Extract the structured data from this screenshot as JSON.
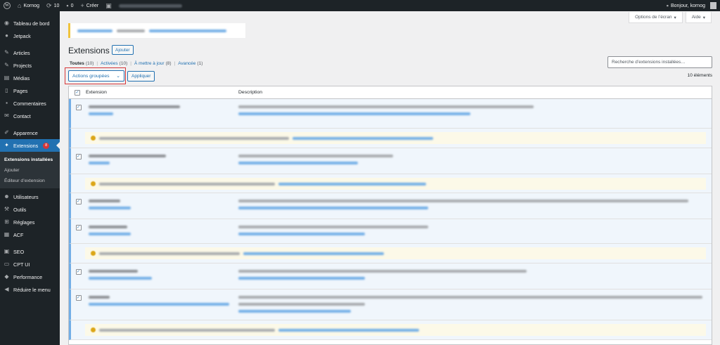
{
  "adminbar": {
    "site_name": "Kornog",
    "updates_count": "10",
    "comments_count": "0",
    "new_label": "Créer",
    "greeting": "Bonjour, kornog"
  },
  "sidebar": {
    "items": [
      {
        "label": "Tableau de bord",
        "icon": "dashboard-icon"
      },
      {
        "label": "Jetpack",
        "icon": "jetpack-icon"
      },
      {
        "label": "Articles",
        "icon": "pin-icon"
      },
      {
        "label": "Projects",
        "icon": "projects-icon"
      },
      {
        "label": "Médias",
        "icon": "media-icon"
      },
      {
        "label": "Pages",
        "icon": "pages-icon"
      },
      {
        "label": "Commentaires",
        "icon": "comments-icon"
      },
      {
        "label": "Contact",
        "icon": "mail-icon"
      },
      {
        "label": "Apparence",
        "icon": "brush-icon"
      },
      {
        "label": "Extensions",
        "icon": "plugins-icon",
        "badge": "8"
      },
      {
        "label": "Utilisateurs",
        "icon": "users-icon"
      },
      {
        "label": "Outils",
        "icon": "tools-icon"
      },
      {
        "label": "Réglages",
        "icon": "settings-icon"
      },
      {
        "label": "ACF",
        "icon": "acf-icon"
      },
      {
        "label": "SEO",
        "icon": "seo-icon"
      },
      {
        "label": "CPT UI",
        "icon": "cptui-icon"
      },
      {
        "label": "Performance",
        "icon": "performance-icon"
      },
      {
        "label": "Réduire le menu",
        "icon": "collapse-icon"
      }
    ],
    "submenu": [
      {
        "label": "Extensions installées"
      },
      {
        "label": "Ajouter"
      },
      {
        "label": "Éditeur d’extension"
      }
    ]
  },
  "screen_options": {
    "options_label": "Options de l’écran",
    "help_label": "Aide"
  },
  "page": {
    "title": "Extensions",
    "add_button": "Ajouter",
    "filters": {
      "all": "Toutes",
      "all_count": "(10)",
      "active": "Activées",
      "active_count": "(10)",
      "updates": "À mettre à jour",
      "updates_count": "(8)",
      "advanced": "Avancée",
      "advanced_count": "(1)"
    },
    "search_placeholder": "Recherche d’extensions installées…",
    "bulk_actions_label": "Actions groupées",
    "apply_label": "Appliquer",
    "items_count": "10 éléments"
  },
  "table": {
    "col_extension": "Extension",
    "col_description": "Description"
  },
  "colors": {
    "admin_dark": "#1d2327",
    "accent": "#2271b1",
    "badge": "#d63638",
    "update_bg": "#fcf9e8",
    "warning": "#dba617"
  }
}
